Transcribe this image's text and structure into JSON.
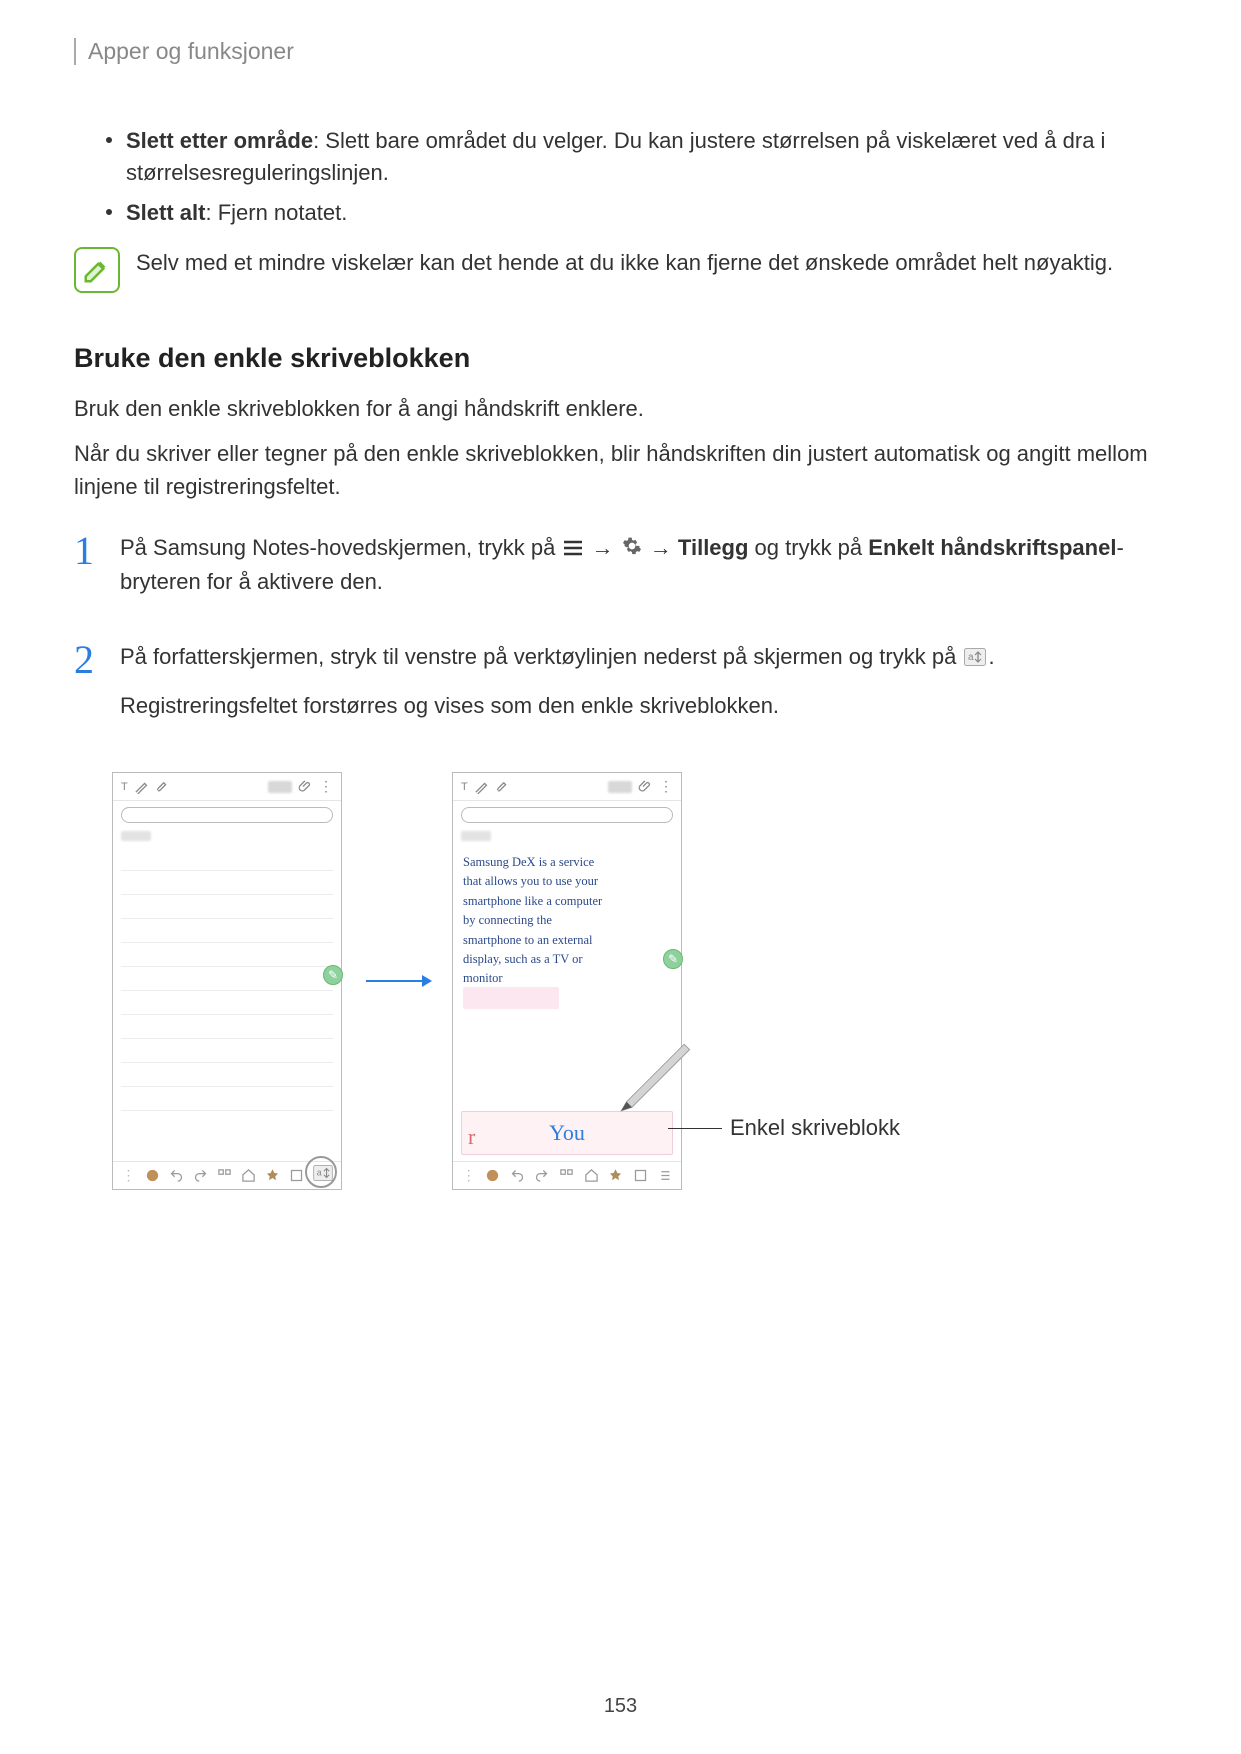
{
  "header": {
    "breadcrumb": "Apper og funksjoner"
  },
  "bullets": [
    {
      "title": "Slett etter område",
      "text": ": Slett bare området du velger. Du kan justere størrelsen på viskelæret ved å dra i størrelsesreguleringslinjen."
    },
    {
      "title": "Slett alt",
      "text": ": Fjern notatet."
    }
  ],
  "note": {
    "text": "Selv med et mindre viskelær kan det hende at du ikke kan fjerne det ønskede området helt nøyaktig."
  },
  "section": {
    "heading": "Bruke den enkle skriveblokken",
    "p1": "Bruk den enkle skriveblokken for å angi håndskrift enklere.",
    "p2": "Når du skriver eller tegner på den enkle skriveblokken, blir håndskriften din justert automatisk og angitt mellom linjene til registreringsfeltet."
  },
  "steps": {
    "s1": {
      "num": "1",
      "pre": "På Samsung Notes-hovedskjermen, trykk på ",
      "mid1": " → ",
      "mid2": " → ",
      "tillegg": "Tillegg",
      "mid3": " og trykk på ",
      "enkelt": "Enkelt håndskriftspanel",
      "post": "-bryteren for å aktivere den."
    },
    "s2": {
      "num": "2",
      "line1_pre": "På forfatterskjermen, stryk til venstre på verktøylinjen nederst på skjermen og trykk på ",
      "line1_post": ".",
      "line2": "Registreringsfeltet forstørres og vises som den enkle skriveblokken."
    }
  },
  "figure": {
    "screenshot_text": [
      "Samsung DeX is a service",
      "that allows you to use your",
      "smartphone like a computer",
      "by connecting the",
      "smartphone to an external",
      "display, such as a TV or",
      "monitor"
    ],
    "easypad_text": "You",
    "easypad_r": "r",
    "callout": "Enkel skriveblokk"
  },
  "page_number": "153"
}
